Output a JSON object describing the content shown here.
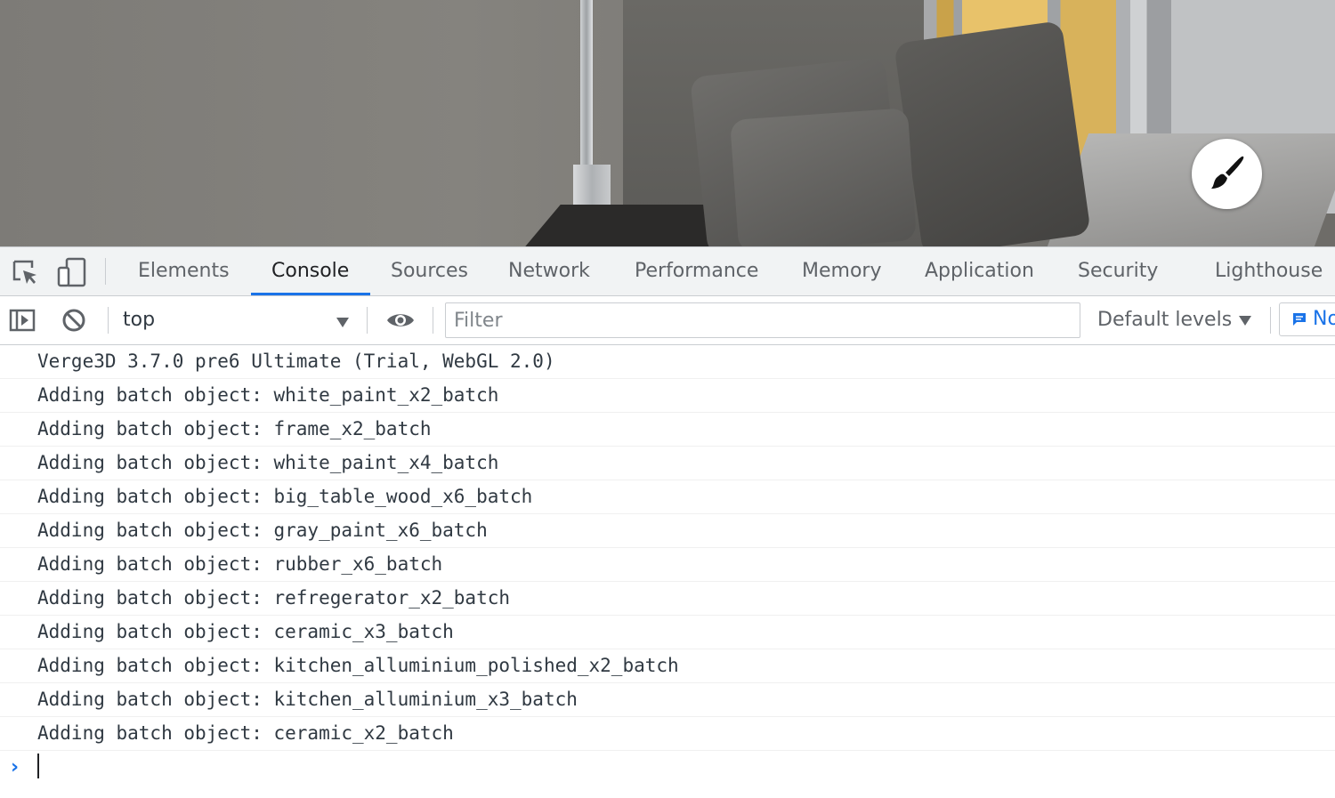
{
  "viewport": {
    "paint_button_icon": "paint-brush-icon"
  },
  "devtools": {
    "tabs": [
      {
        "label": "Elements",
        "active": false
      },
      {
        "label": "Console",
        "active": true
      },
      {
        "label": "Sources",
        "active": false
      },
      {
        "label": "Network",
        "active": false
      },
      {
        "label": "Performance",
        "active": false
      },
      {
        "label": "Memory",
        "active": false
      },
      {
        "label": "Application",
        "active": false
      },
      {
        "label": "Security",
        "active": false
      },
      {
        "label": "Lighthouse",
        "active": false
      }
    ],
    "accent_color": "#1a73e8",
    "toolbar": {
      "context": "top",
      "filter_placeholder": "Filter",
      "filter_value": "",
      "levels_label": "Default levels",
      "issues_label": "No"
    },
    "console_messages": [
      "Verge3D 3.7.0 pre6 Ultimate (Trial, WebGL 2.0)",
      "Adding batch object: white_paint_x2_batch",
      "Adding batch object: frame_x2_batch",
      "Adding batch object: white_paint_x4_batch",
      "Adding batch object: big_table_wood_x6_batch",
      "Adding batch object: gray_paint_x6_batch",
      "Adding batch object: rubber_x6_batch",
      "Adding batch object: refregerator_x2_batch",
      "Adding batch object: ceramic_x3_batch",
      "Adding batch object: kitchen_alluminium_polished_x2_batch",
      "Adding batch object: kitchen_alluminium_x3_batch",
      "Adding batch object: ceramic_x2_batch"
    ],
    "prompt_symbol": "›"
  }
}
